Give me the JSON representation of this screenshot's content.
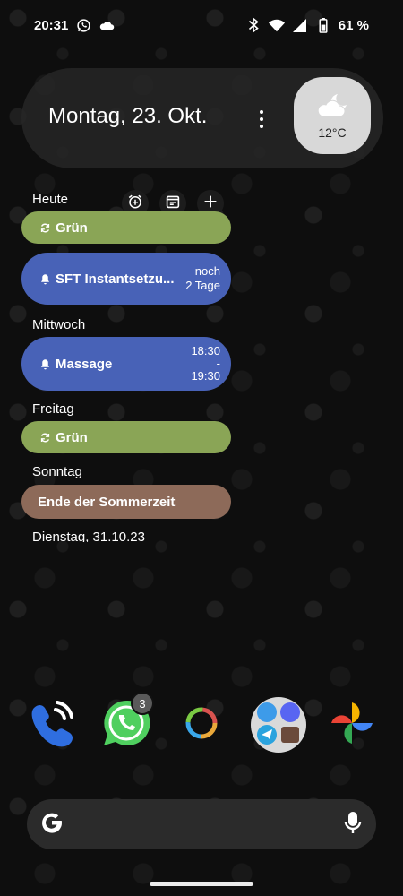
{
  "status_bar": {
    "time": "20:31",
    "battery": "61 %",
    "icons": [
      "whatsapp-icon",
      "cloud-icon",
      "bluetooth-icon",
      "wifi-icon",
      "signal-icon",
      "battery-icon"
    ]
  },
  "at_a_glance": {
    "date": "Montag, 23. Okt.",
    "weather_temp": "12°C",
    "weather_icon": "partly-cloudy-night-icon"
  },
  "agenda": {
    "today_label": "Heute",
    "actions": [
      "add-alarm-icon",
      "calendar-icon",
      "plus-icon"
    ],
    "events": [
      {
        "title": "Grün",
        "icon": "sync-icon"
      },
      {
        "title": "SFT Instantsetzu...",
        "icon": "bell-icon",
        "meta_line1": "noch",
        "meta_line2": "2 Tage"
      },
      {
        "title": "Massage",
        "icon": "bell-icon",
        "meta_line1": "18:30",
        "meta_sep": "-",
        "meta_line2": "19:30"
      },
      {
        "title": "Grün",
        "icon": "sync-icon"
      },
      {
        "title": "Ende der Sommerzeit"
      }
    ],
    "wednesday_label": "Mittwoch",
    "friday_label": "Freitag",
    "sunday_label": "Sonntag",
    "next_label": "Dienstag, 31.10.23"
  },
  "dock": {
    "apps": [
      "phone-icon",
      "whatsapp-icon",
      "circle-app-icon",
      "folder-icon",
      "photos-icon"
    ],
    "whatsapp_badge": "3"
  },
  "search": {
    "icons": [
      "google-g-icon",
      "mic-icon"
    ]
  },
  "colors": {
    "green_event": "#8aa556",
    "blue_event": "#4862b7",
    "brown_event": "#8d6a59"
  }
}
